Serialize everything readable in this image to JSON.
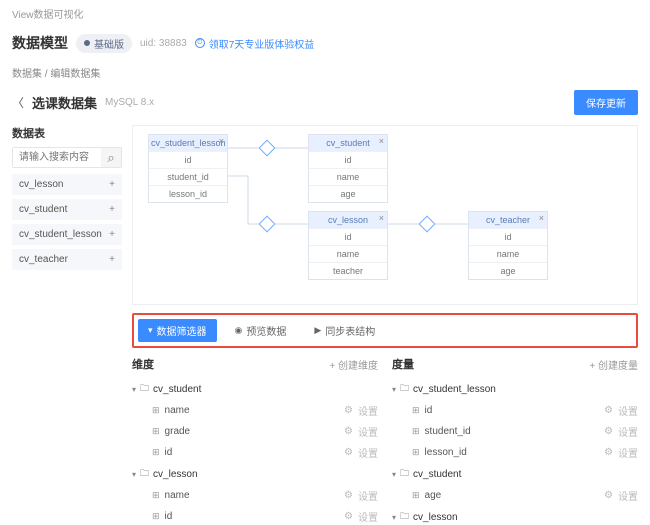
{
  "app_title": "View数据可视化",
  "header": {
    "title": "数据模型",
    "badge": "基础版",
    "uid": "uid: 38883",
    "promo": "领取7天专业版体验权益"
  },
  "crumbs": {
    "a": "数据集",
    "sep": " / ",
    "b": "编辑数据集"
  },
  "sub": {
    "title": "选课数据集",
    "db": "MySQL 8.x",
    "save": "保存更新"
  },
  "side": {
    "title": "数据表",
    "placeholder": "请输入搜索内容",
    "tables": [
      "cv_lesson",
      "cv_student",
      "cv_student_lesson",
      "cv_teacher"
    ]
  },
  "canvas": {
    "e1": {
      "name": "cv_student_lesson",
      "f": [
        "id",
        "student_id",
        "lesson_id"
      ]
    },
    "e2": {
      "name": "cv_student",
      "f": [
        "id",
        "name",
        "age"
      ]
    },
    "e3": {
      "name": "cv_lesson",
      "f": [
        "id",
        "name",
        "teacher"
      ]
    },
    "e4": {
      "name": "cv_teacher",
      "f": [
        "id",
        "name",
        "age"
      ]
    }
  },
  "tabs": {
    "a": "数据筛选器",
    "b": "预览数据",
    "c": "同步表结构"
  },
  "dim": {
    "title": "维度",
    "add": "+ 创建维度",
    "g1": {
      "name": "cv_student",
      "f": [
        "name",
        "grade",
        "id"
      ]
    },
    "g2": {
      "name": "cv_lesson",
      "f": [
        "name",
        "id"
      ]
    }
  },
  "met": {
    "title": "度量",
    "add": "+ 创建度量",
    "g1": {
      "name": "cv_student_lesson",
      "f": [
        "id",
        "student_id",
        "lesson_id"
      ]
    },
    "g2": {
      "name": "cv_student",
      "f": [
        "age"
      ]
    },
    "g3": {
      "name": "cv_lesson"
    }
  },
  "cfg_label": "设置"
}
